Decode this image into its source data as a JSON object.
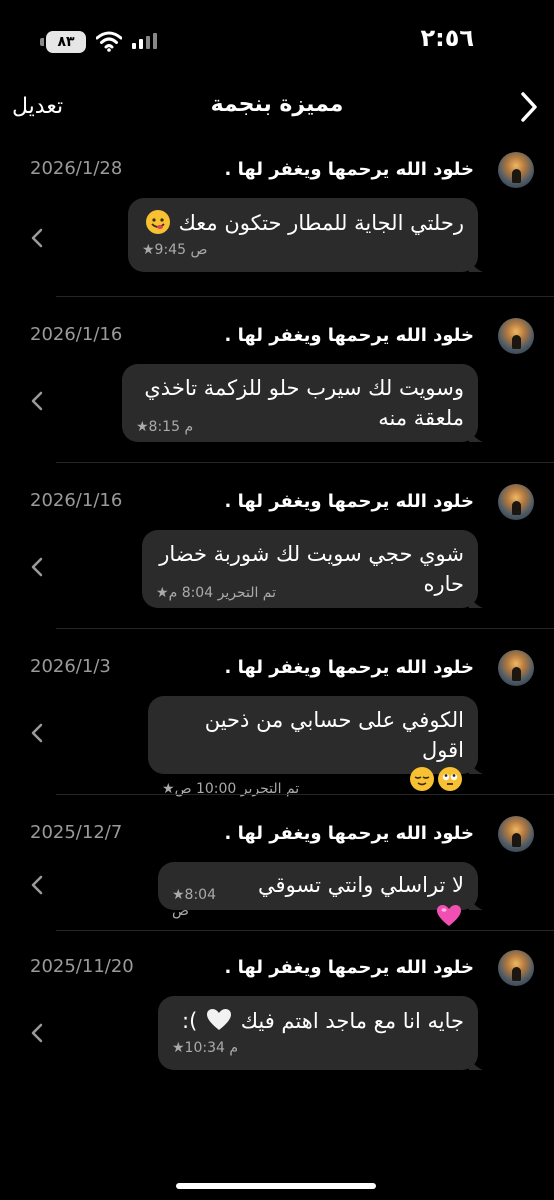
{
  "status_bar": {
    "time": "٢:٥٦",
    "battery": "٨٣"
  },
  "nav": {
    "edit_label": "تعديل",
    "title": "مميزة بنجمة"
  },
  "messages": [
    {
      "sender": "خلود الله يرحمها ويغفر لها .",
      "date": "2026/1/28",
      "text": "رحلتي الجاية للمطار حتكون معك",
      "emoji": "smile",
      "meta": "★9:45 ص"
    },
    {
      "sender": "خلود الله يرحمها ويغفر لها .",
      "date": "2026/1/16",
      "text": "وسويت لك سيرب حلو للزكمة تاخذي ملعقة منه",
      "meta": "★8:15 م"
    },
    {
      "sender": "خلود الله يرحمها ويغفر لها .",
      "date": "2026/1/16",
      "text": "شوي حجي سويت لك شوربة خضار حاره",
      "meta": "★تم التحرير 8:04 م"
    },
    {
      "sender": "خلود الله يرحمها ويغفر لها .",
      "date": "2026/1/3",
      "text": "الكوفي على حسابي من ذحين اقول",
      "emoji": "eyes-relief",
      "meta": "★تم التحرير 10:00 ص"
    },
    {
      "sender": "خلود الله يرحمها ويغفر لها .",
      "date": "2025/12/7",
      "text": "لا تراسلي وانتي تسوقي",
      "emoji": "pink-heart",
      "meta": "★8:04 ص"
    },
    {
      "sender": "خلود الله يرحمها ويغفر لها .",
      "date": "2025/11/20",
      "text": "جايه انا مع ماجد اهتم فيك",
      "emoji": "white-heart",
      "suffix": " ):",
      "meta": "★10:34 م"
    }
  ],
  "colors": {
    "background": "#000000",
    "bubble": "#2b2b2b",
    "date": "#9a9a9a",
    "divider": "#262626"
  }
}
